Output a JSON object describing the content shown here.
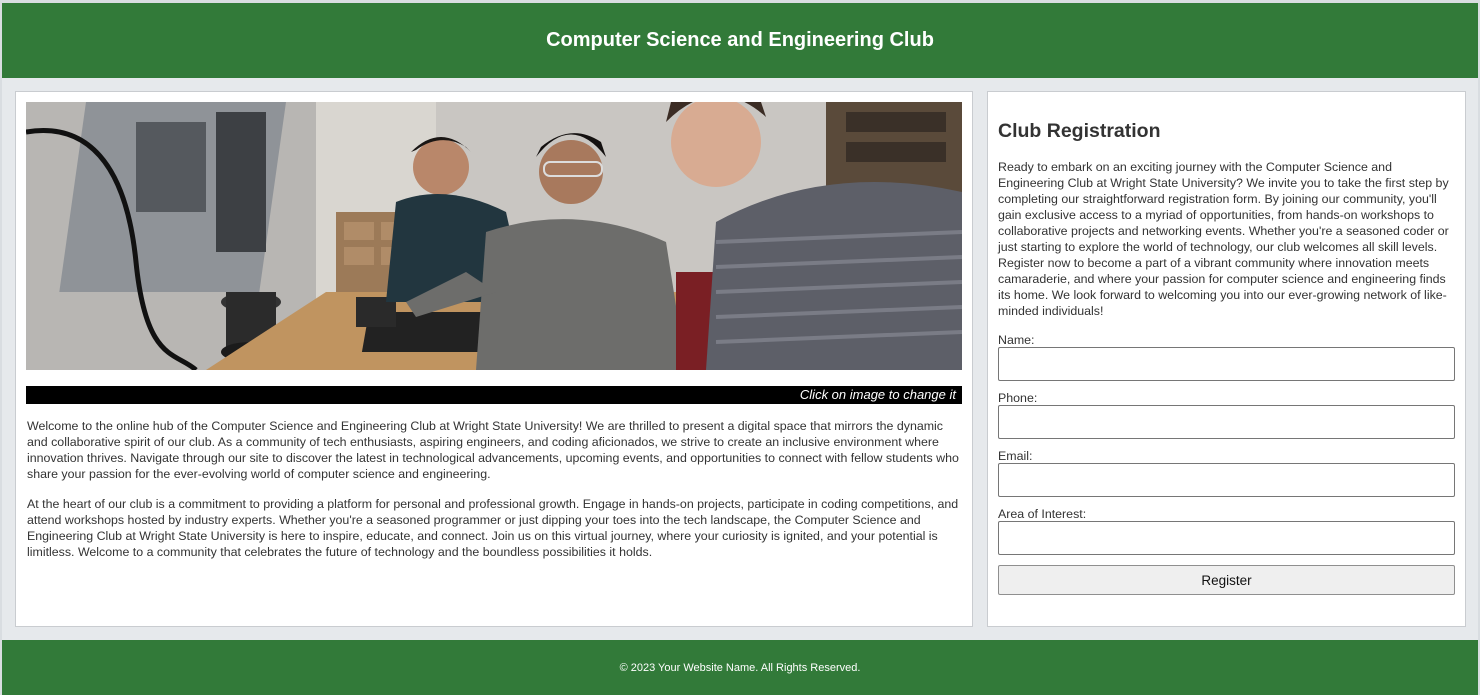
{
  "header": {
    "title": "Computer Science and Engineering Club"
  },
  "hero": {
    "caption": "Click on image to change it",
    "image_description_icon": "photo-students-electronics-lab"
  },
  "intro": {
    "paragraphs": [
      "Welcome to the online hub of the Computer Science and Engineering Club at Wright State University! We are thrilled to present a digital space that mirrors the dynamic and collaborative spirit of our club. As a community of tech enthusiasts, aspiring engineers, and coding aficionados, we strive to create an inclusive environment where innovation thrives. Navigate through our site to discover the latest in technological advancements, upcoming events, and opportunities to connect with fellow students who share your passion for the ever-evolving world of computer science and engineering.",
      "At the heart of our club is a commitment to providing a platform for personal and professional growth. Engage in hands-on projects, participate in coding competitions, and attend workshops hosted by industry experts. Whether you're a seasoned programmer or just dipping your toes into the tech landscape, the Computer Science and Engineering Club at Wright State University is here to inspire, educate, and connect. Join us on this virtual journey, where your curiosity is ignited, and your potential is limitless. Welcome to a community that celebrates the future of technology and the boundless possibilities it holds."
    ]
  },
  "registration": {
    "title": "Club Registration",
    "intro": "Ready to embark on an exciting journey with the Computer Science and Engineering Club at Wright State University? We invite you to take the first step by completing our straightforward registration form. By joining our community, you'll gain exclusive access to a myriad of opportunities, from hands-on workshops to collaborative projects and networking events. Whether you're a seasoned coder or just starting to explore the world of technology, our club welcomes all skill levels. Register now to become a part of a vibrant community where innovation meets camaraderie, and where your passion for computer science and engineering finds its home. We look forward to welcoming you into our ever-growing network of like-minded individuals!",
    "fields": {
      "name": {
        "label": "Name:",
        "value": ""
      },
      "phone": {
        "label": "Phone:",
        "value": ""
      },
      "email": {
        "label": "Email:",
        "value": ""
      },
      "interest": {
        "label": "Area of Interest:",
        "value": ""
      }
    },
    "submit_label": "Register"
  },
  "footer": {
    "text": "© 2023 Your Website Name. All Rights Reserved."
  },
  "colors": {
    "brand_green": "#327a39",
    "page_background": "#e6e9ec",
    "caption_bar": "#000000"
  }
}
